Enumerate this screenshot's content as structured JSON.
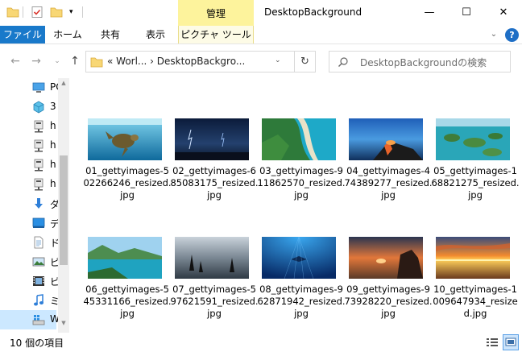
{
  "window": {
    "title": "DesktopBackground",
    "context_tab": "管理"
  },
  "ribbon": {
    "tabs": [
      "ファイル",
      "ホーム",
      "共有",
      "表示",
      "ピクチャ ツール"
    ]
  },
  "address": {
    "path": "«  Worl...  ›  DesktopBackgro...",
    "search_placeholder": "DesktopBackgroundの検索"
  },
  "sidebar": {
    "items": [
      {
        "label": "PC",
        "icon": "pc-icon"
      },
      {
        "label": "3",
        "icon": "3d-objects-icon"
      },
      {
        "label": "h",
        "icon": "network-drive-icon"
      },
      {
        "label": "h",
        "icon": "network-drive-icon"
      },
      {
        "label": "h",
        "icon": "network-drive-icon"
      },
      {
        "label": "h",
        "icon": "network-drive-icon"
      },
      {
        "label": "ダ",
        "icon": "downloads-icon"
      },
      {
        "label": "デ",
        "icon": "desktop-icon"
      },
      {
        "label": "ド",
        "icon": "documents-icon"
      },
      {
        "label": "ピ",
        "icon": "pictures-icon"
      },
      {
        "label": "ビ",
        "icon": "videos-icon"
      },
      {
        "label": "ミ",
        "icon": "music-icon"
      },
      {
        "label": "W",
        "icon": "windows-drive-icon"
      }
    ]
  },
  "files": [
    {
      "name": "01_gettyimages-502266246_resized.jpg",
      "lines": [
        "01_gettyimages-5",
        "02266246_resized.",
        "jpg"
      ]
    },
    {
      "name": "02_gettyimages-685083175_resized.jpg",
      "lines": [
        "02_gettyimages-6",
        "85083175_resized.",
        "jpg"
      ]
    },
    {
      "name": "03_gettyimages-911862570_resized.jpg",
      "lines": [
        "03_gettyimages-9",
        "11862570_resized.",
        "jpg"
      ]
    },
    {
      "name": "04_gettyimages-474389277_resized.jpg",
      "lines": [
        "04_gettyimages-4",
        "74389277_resized.",
        "jpg"
      ]
    },
    {
      "name": "05_gettyimages-168821275_resized.jpg",
      "lines": [
        "05_gettyimages-1",
        "68821275_resized.",
        "jpg"
      ]
    },
    {
      "name": "06_gettyimages-545331166_resized.jpg",
      "lines": [
        "06_gettyimages-5",
        "45331166_resized.",
        "jpg"
      ]
    },
    {
      "name": "07_gettyimages-597621591_resized.jpg",
      "lines": [
        "07_gettyimages-5",
        "97621591_resized.",
        "jpg"
      ]
    },
    {
      "name": "08_gettyimages-962871942_resized.jpg",
      "lines": [
        "08_gettyimages-9",
        "62871942_resized.",
        "jpg"
      ]
    },
    {
      "name": "09_gettyimages-973928220_resized.jpg",
      "lines": [
        "09_gettyimages-9",
        "73928220_resized.",
        "jpg"
      ]
    },
    {
      "name": "10_gettyimages-1009647934_resized.jpg",
      "lines": [
        "10_gettyimages-1",
        "009647934_resize",
        "d.jpg"
      ]
    }
  ],
  "status": {
    "item_count": "10 個の項目"
  },
  "colors": {
    "file_tab": "#1979ca",
    "context_tab": "#fdf39c",
    "selection": "#cce8ff"
  }
}
